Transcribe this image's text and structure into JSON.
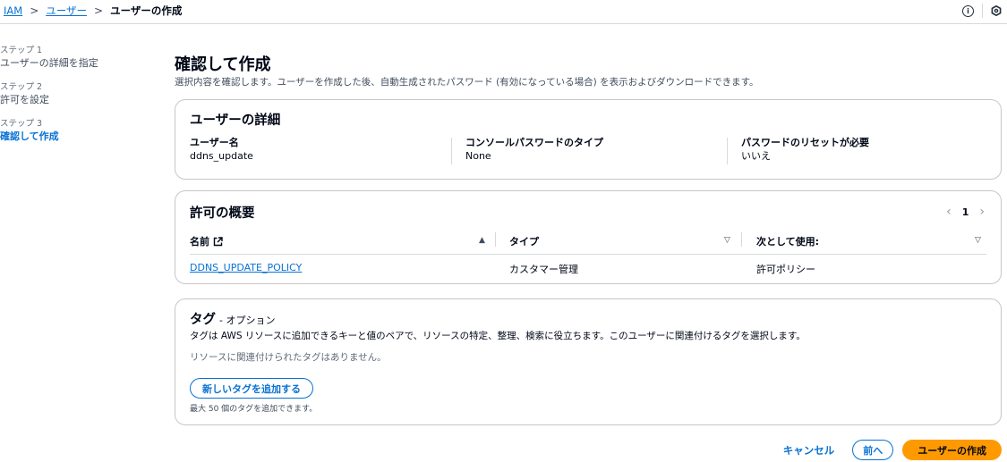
{
  "breadcrumb": {
    "items": [
      "IAM",
      "ユーザー"
    ],
    "current": "ユーザーの作成",
    "separator": ">"
  },
  "header_icons": [
    "info-icon",
    "settings-hex-icon"
  ],
  "steps": [
    {
      "num": "ステップ 1",
      "label": "ユーザーの詳細を指定",
      "active": false
    },
    {
      "num": "ステップ 2",
      "label": "許可を設定",
      "active": false
    },
    {
      "num": "ステップ 3",
      "label": "確認して作成",
      "active": true
    }
  ],
  "page": {
    "title": "確認して作成",
    "description": "選択内容を確認します。ユーザーを作成した後、自動生成されたパスワード (有効になっている場合) を表示およびダウンロードできます。"
  },
  "user_details": {
    "title": "ユーザーの詳細",
    "fields": [
      {
        "key": "ユーザー名",
        "value": "ddns_update"
      },
      {
        "key": "コンソールパスワードのタイプ",
        "value": "None"
      },
      {
        "key": "パスワードのリセットが必要",
        "value": "いいえ"
      }
    ]
  },
  "permissions": {
    "title": "許可の概要",
    "page": "1",
    "prev_arrow": "‹",
    "next_arrow": "›",
    "columns": [
      "名前",
      "タイプ",
      "次として使用:"
    ],
    "rows": [
      {
        "name": "DDNS_UPDATE_POLICY",
        "type": "カスタマー管理",
        "used_as": "許可ポリシー"
      }
    ]
  },
  "tags": {
    "title": "タグ",
    "optional": "- オプション",
    "description": "タグは AWS リソースに追加できるキーと値のペアで、リソースの特定、整理、検索に役立ちます。このユーザーに関連付けるタグを選択します。",
    "empty": "リソースに関連付けられたタグはありません。",
    "add_button": "新しいタグを追加する",
    "hint": "最大 50 個のタグを追加できます。"
  },
  "footer": {
    "cancel": "キャンセル",
    "previous": "前へ",
    "create": "ユーザーの作成"
  },
  "colors": {
    "link": "#0972d3",
    "primary": "#ff9900",
    "text": "#000716"
  }
}
